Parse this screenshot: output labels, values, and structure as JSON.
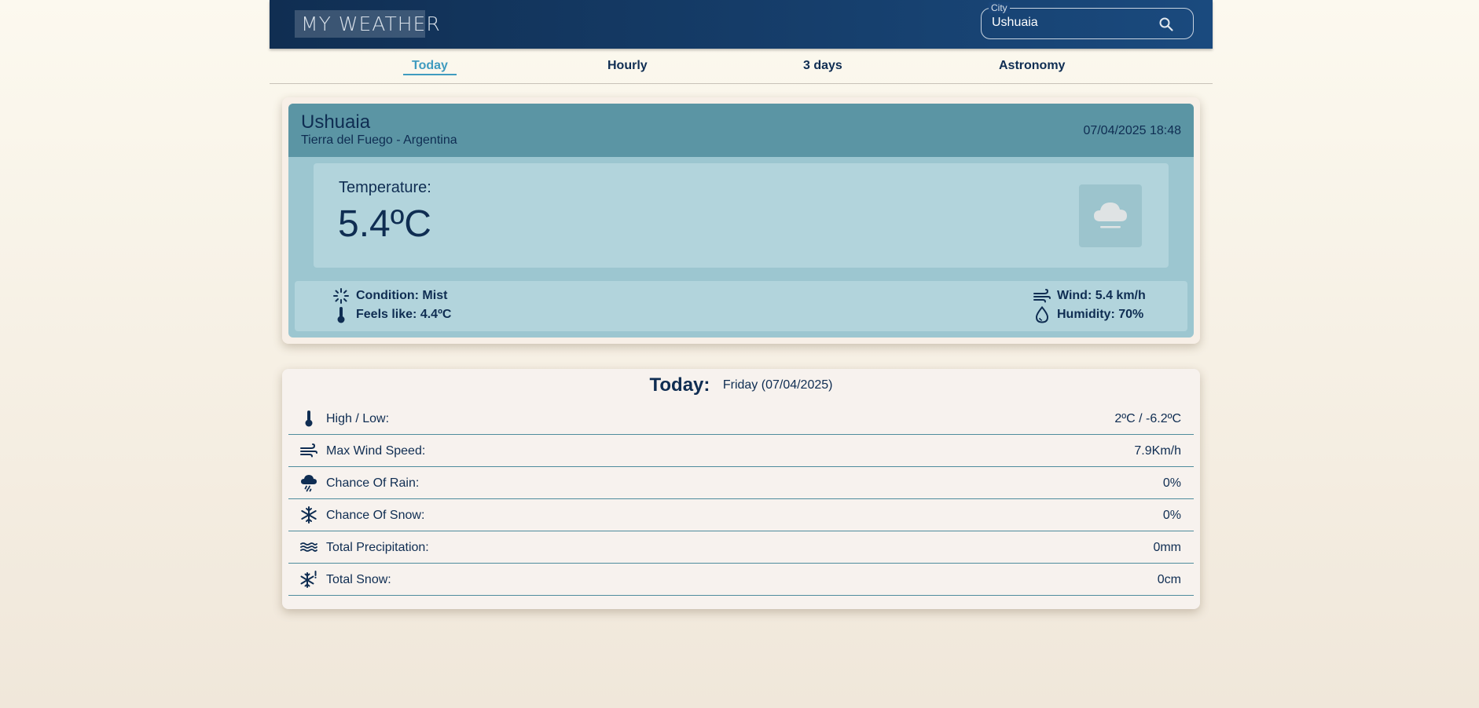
{
  "header": {
    "logo_text": "MY WEATHER",
    "city_label": "City",
    "city_value": "Ushuaia"
  },
  "tabs": [
    {
      "label": "Today",
      "active": true
    },
    {
      "label": "Hourly",
      "active": false
    },
    {
      "label": "3 days",
      "active": false
    },
    {
      "label": "Astronomy",
      "active": false
    }
  ],
  "current": {
    "city": "Ushuaia",
    "region": "Tierra del Fuego - Argentina",
    "datetime": "07/04/2025 18:48",
    "temperature_label": "Temperature:",
    "temperature": "5.4ºC",
    "weather_icon": "mist-cloud-icon",
    "condition": "Condition: Mist",
    "feels_like": "Feels like: 4.4ºC",
    "wind": "Wind: 5.4 km/h",
    "humidity": "Humidity: 70%"
  },
  "today": {
    "title": "Today:",
    "date": "Friday (07/04/2025)",
    "rows": [
      {
        "icon": "thermometer-icon",
        "label": "High / Low:",
        "value": "2ºC / -6.2ºC"
      },
      {
        "icon": "wind-icon",
        "label": "Max Wind Speed:",
        "value": "7.9Km/h"
      },
      {
        "icon": "rain-cloud-icon",
        "label": "Chance Of Rain:",
        "value": "0%"
      },
      {
        "icon": "snowflake-icon",
        "label": "Chance Of Snow:",
        "value": "0%"
      },
      {
        "icon": "waves-icon",
        "label": "Total Precipitation:",
        "value": "0mm"
      },
      {
        "icon": "snow-alert-icon",
        "label": "Total Snow:",
        "value": "0cm"
      }
    ]
  },
  "colors": {
    "header_start": "#102e52",
    "header_end": "#1a4a7e",
    "accent": "#3f9bbf",
    "text": "#0f2d52",
    "card_head": "#5b95a4",
    "card_body": "#9cc6d0",
    "card_panel": "#b2d4dc"
  }
}
